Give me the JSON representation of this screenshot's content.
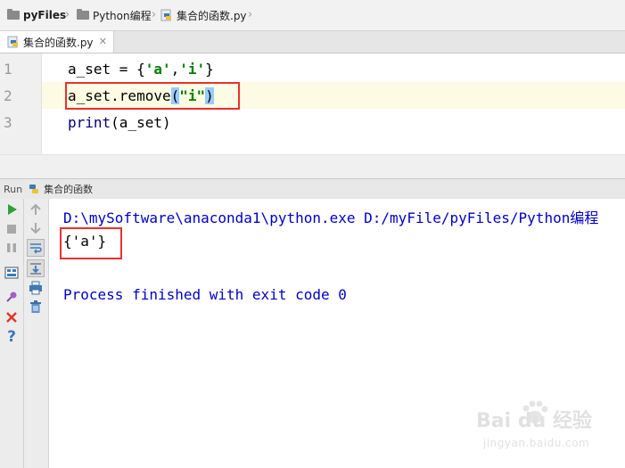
{
  "breadcrumb": {
    "items": [
      {
        "label": "pyFiles",
        "icon": "folder-icon"
      },
      {
        "label": "Python编程",
        "icon": "folder-icon"
      },
      {
        "label": "集合的函数.py",
        "icon": "python-file-icon"
      }
    ]
  },
  "editor": {
    "tab_label": "集合的函数.py",
    "line_numbers": [
      "1",
      "2",
      "3"
    ],
    "lines": {
      "l1_prefix": "a_set = {",
      "l1_str1": "'a'",
      "l1_comma": ",",
      "l1_str2": "'i'",
      "l1_suffix": "}",
      "l2_prefix": "a_set.remove",
      "l2_open": "(",
      "l2_str": "\"i\"",
      "l2_close": ")",
      "l3_kw": "print",
      "l3_rest": "(a_set)"
    }
  },
  "run_panel": {
    "label": "Run",
    "config_name": "集合的函数"
  },
  "console": {
    "command": "D:\\mySoftware\\anaconda1\\python.exe D:/myFile/pyFiles/Python编程",
    "output": "{'a'}",
    "exit_message": "Process finished with exit code 0"
  },
  "watermark": {
    "text": "Bai du 经验",
    "sub": "jingyan.baidu.com"
  },
  "colors": {
    "highlight_box": "#e8312f",
    "string": "#008000",
    "console_blue": "#0000c8",
    "current_line": "#fdfbe3"
  }
}
